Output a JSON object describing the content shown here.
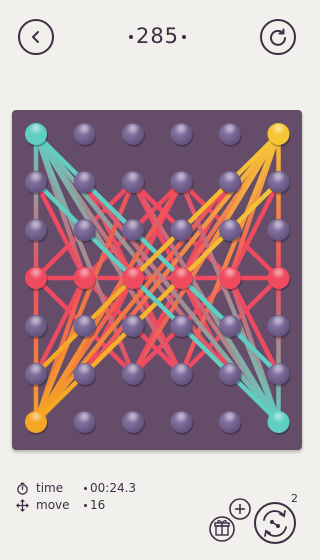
{
  "level": {
    "number": "285"
  },
  "buttons": {
    "back_icon": "chevron-left-icon",
    "restart_icon": "restart-icon"
  },
  "board": {
    "background": "#654d6a",
    "columns": 6,
    "rows": 7,
    "colors": {
      "teal": "#5ecfc2",
      "orange": "#f5a623",
      "yellow": "#f5c635",
      "red": "#ef4a5f",
      "pin": "#6a5a84"
    }
  },
  "stats": {
    "time_icon": "stopwatch-icon",
    "time_label": "time",
    "time_value": "00:24.3",
    "move_icon": "move-arrows-icon",
    "move_label": "move",
    "move_value": "16"
  },
  "hints": {
    "count": "2",
    "gift_icon": "gift-icon",
    "plus_icon": "plus-icon",
    "hint_icon": "hint-swap-icon"
  }
}
